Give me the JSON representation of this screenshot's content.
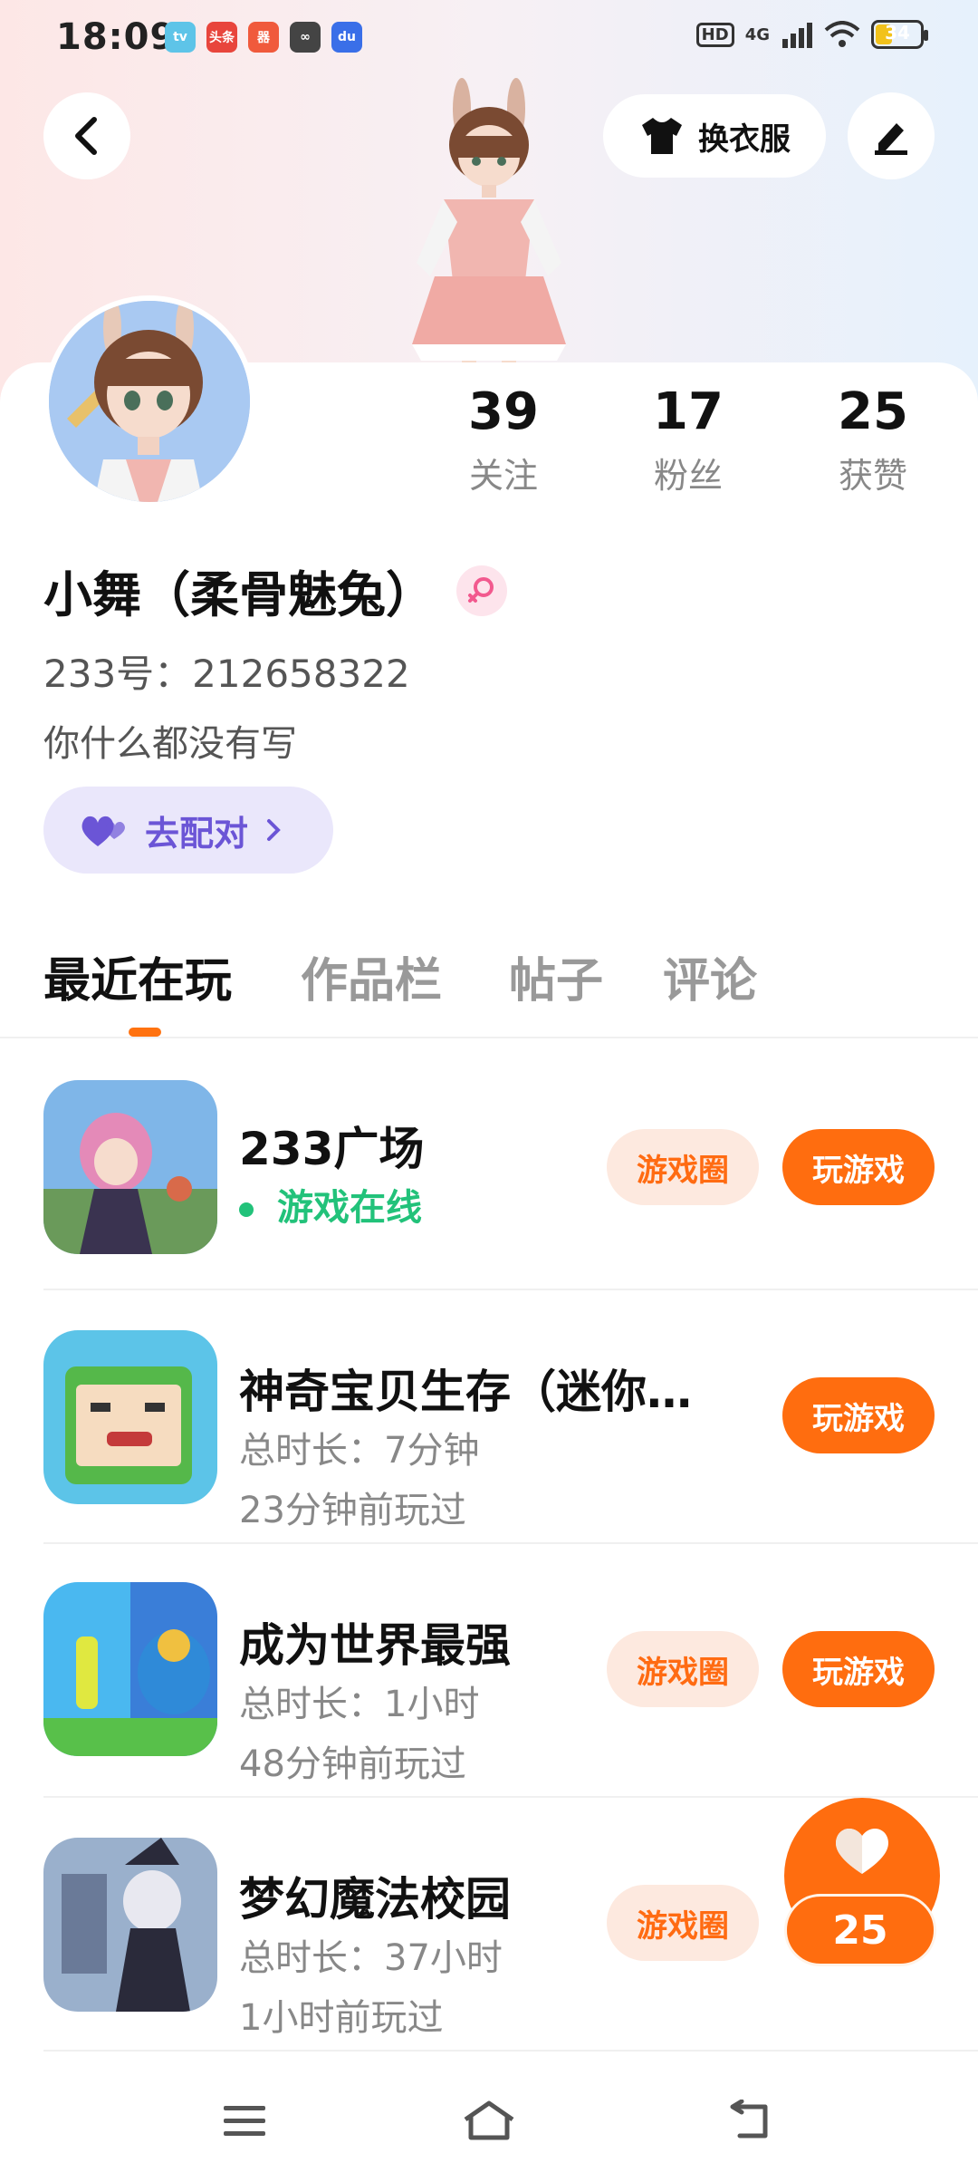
{
  "status_bar": {
    "time": "18:09",
    "apps": [
      {
        "label": "tv",
        "color": "#5ec4e8"
      },
      {
        "label": "头条",
        "color": "#e8453c"
      },
      {
        "label": "器",
        "color": "#f05a3c"
      },
      {
        "label": "∞",
        "color": "#444444"
      },
      {
        "label": "du",
        "color": "#3a6fe8"
      }
    ],
    "hd": "HD",
    "network": "4G",
    "battery": "34",
    "battery_level": 0.34
  },
  "header": {
    "back_icon": "chevron-left-icon",
    "outfit_label": "换衣服",
    "outfit_icon": "tshirt-icon",
    "edit_icon": "pen-icon"
  },
  "profile": {
    "stats": [
      {
        "value": "39",
        "label": "关注"
      },
      {
        "value": "17",
        "label": "粉丝"
      },
      {
        "value": "25",
        "label": "获赞"
      }
    ],
    "nickname": "小舞（柔骨魅兔）",
    "gender_icon": "female-icon",
    "uid": "233号：212658322",
    "bio": "你什么都没有写",
    "match_label": "去配对",
    "accent_color": "#ff6d0f"
  },
  "tabs": [
    {
      "label": "最近在玩",
      "active": true
    },
    {
      "label": "作品栏",
      "active": false
    },
    {
      "label": "帖子",
      "active": false
    },
    {
      "label": "评论",
      "active": false
    }
  ],
  "games": [
    {
      "title": "233广场",
      "line1": "游戏在线",
      "line2": "",
      "online": true,
      "circle_label": "游戏圈",
      "play_label": "玩游戏"
    },
    {
      "title": "神奇宝贝生存（迷你…",
      "line1": "总时长：7分钟",
      "line2": "23分钟前玩过",
      "online": false,
      "circle_label": "",
      "play_label": "玩游戏"
    },
    {
      "title": "成为世界最强",
      "line1": "总时长：1小时",
      "line2": "48分钟前玩过",
      "online": false,
      "circle_label": "游戏圈",
      "play_label": "玩游戏"
    },
    {
      "title": "梦幻魔法校园",
      "line1": "总时长：37小时",
      "line2": "1小时前玩过",
      "online": false,
      "circle_label": "游戏圈",
      "play_label": ""
    }
  ],
  "like_fab": {
    "count": "25",
    "icon": "heart-icon"
  },
  "nav": {
    "menu_icon": "menu-icon",
    "home_icon": "home-icon",
    "back_icon": "back-icon"
  }
}
